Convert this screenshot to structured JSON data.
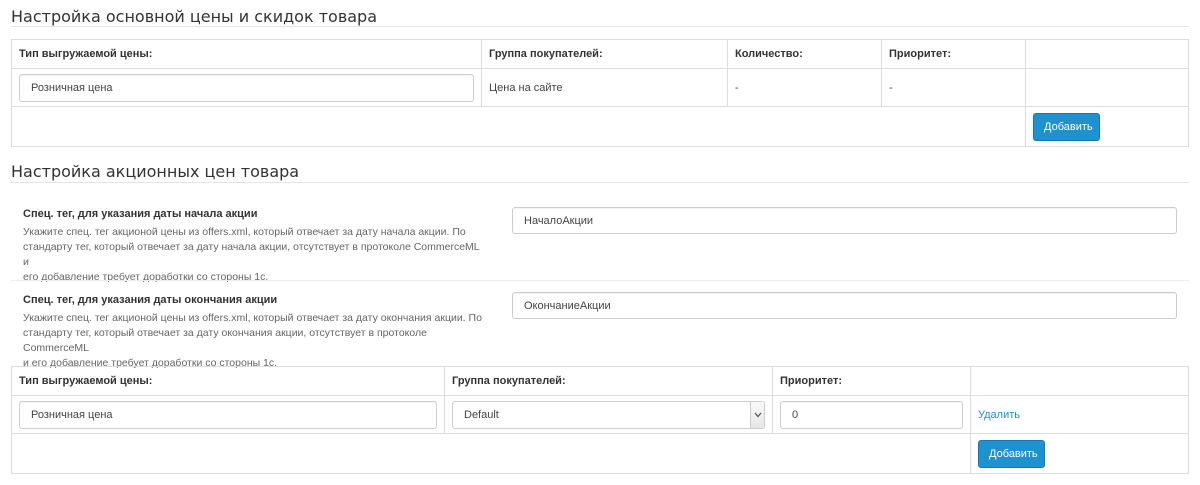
{
  "base_prices": {
    "title": "Настройка основной цены и скидок товара",
    "headers": {
      "price_type": "Тип выгружаемой цены:",
      "customer_group": "Группа покупателей:",
      "quantity": "Количество:",
      "priority": "Приоритет:"
    },
    "row": {
      "price_type_value": "Розничная цена",
      "customer_group": "Цена на сайте",
      "quantity": "-",
      "priority": "-"
    },
    "add_button": "Добавить"
  },
  "promo_prices": {
    "title": "Настройка акционных цен товара",
    "start_tag": {
      "label": "Спец. тег, для указания даты начала акции",
      "help_line1": "Укажите спец. тег акционой цены из offers.xml, который отвечает за дату начала акции. По",
      "help_line2": "стандарту тег, который отвечает за дату начала акции, отсутствует в протоколе CommerceML и",
      "help_line3": "его добавление требует доработки со стороны 1с.",
      "value": "НачалоАкции"
    },
    "end_tag": {
      "label": "Спец. тег, для указания даты окончания акции",
      "help_line1": "Укажите спец. тег акционой цены из offers.xml, который отвечает за дату окончания акции. По",
      "help_line2": "стандарту тег, который отвечает за дату окончания акции, отсутствует в протоколе CommerceML",
      "help_line3": "и его добавление требует доработки со стороны 1с.",
      "value": "ОкончаниеАкции"
    },
    "headers": {
      "price_type": "Тип выгружаемой цены:",
      "customer_group": "Группа покупателей:",
      "priority": "Приоритет:"
    },
    "row": {
      "price_type_value": "Розничная цена",
      "customer_group_value": "Default",
      "priority_value": "0",
      "delete_link": "Удалить"
    },
    "add_button": "Добавить"
  },
  "colors": {
    "accent": "#1e91cf",
    "border": "#dddddd",
    "text": "#333333"
  }
}
